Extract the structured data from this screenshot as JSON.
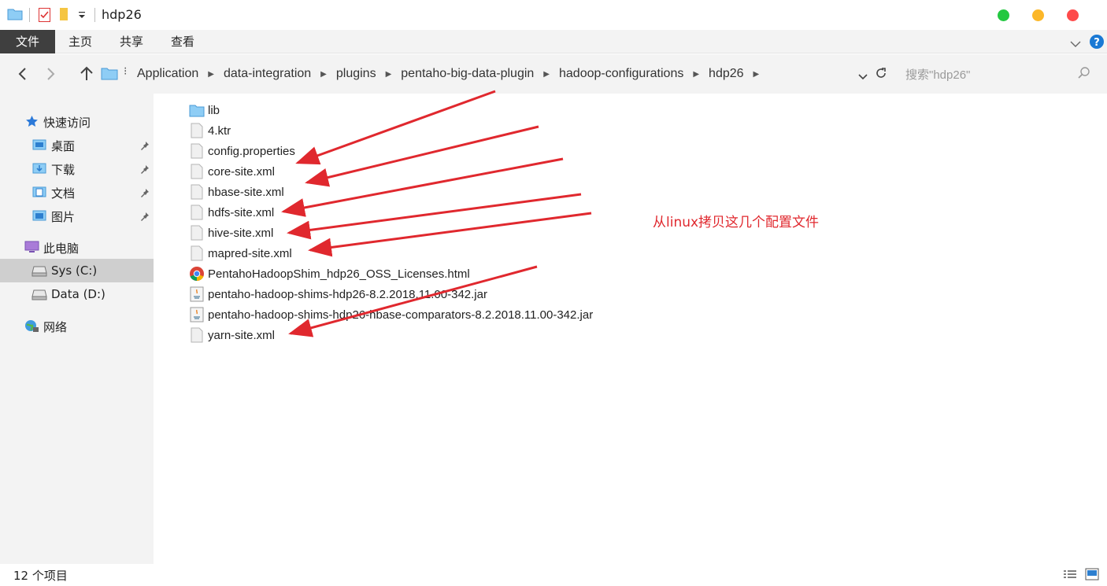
{
  "window": {
    "title": "hdp26"
  },
  "ribbon": {
    "tabs": [
      {
        "label": "文件"
      },
      {
        "label": "主页"
      },
      {
        "label": "共享"
      },
      {
        "label": "查看"
      }
    ]
  },
  "address": {
    "crumbs": [
      "Application",
      "data-integration",
      "plugins",
      "pentaho-big-data-plugin",
      "hadoop-configurations",
      "hdp26"
    ],
    "search_placeholder": "搜索\"hdp26\""
  },
  "sidebar": {
    "items": [
      {
        "label": "快速访问",
        "icon": "star-icon"
      },
      {
        "label": "桌面",
        "icon": "desktop-folder-icon",
        "pinned": true
      },
      {
        "label": "下载",
        "icon": "download-folder-icon",
        "pinned": true
      },
      {
        "label": "文档",
        "icon": "documents-folder-icon",
        "pinned": true
      },
      {
        "label": "图片",
        "icon": "pictures-folder-icon",
        "pinned": true
      },
      {
        "label": "此电脑",
        "icon": "computer-icon"
      },
      {
        "label": "Sys (C:)",
        "icon": "drive-icon",
        "selected": true
      },
      {
        "label": "Data (D:)",
        "icon": "drive-icon"
      },
      {
        "label": "网络",
        "icon": "network-icon"
      }
    ]
  },
  "files": [
    {
      "name": "lib",
      "type": "folder"
    },
    {
      "name": "4.ktr",
      "type": "file"
    },
    {
      "name": "config.properties",
      "type": "file"
    },
    {
      "name": "core-site.xml",
      "type": "file"
    },
    {
      "name": "hbase-site.xml",
      "type": "file"
    },
    {
      "name": "hdfs-site.xml",
      "type": "file"
    },
    {
      "name": "hive-site.xml",
      "type": "file"
    },
    {
      "name": "mapred-site.xml",
      "type": "file"
    },
    {
      "name": "PentahoHadoopShim_hdp26_OSS_Licenses.html",
      "type": "html"
    },
    {
      "name": "pentaho-hadoop-shims-hdp26-8.2.2018.11.00-342.jar",
      "type": "jar"
    },
    {
      "name": "pentaho-hadoop-shims-hdp26-hbase-comparators-8.2.2018.11.00-342.jar",
      "type": "jar"
    },
    {
      "name": "yarn-site.xml",
      "type": "file"
    }
  ],
  "annotation": {
    "text": "从linux拷贝这几个配置文件",
    "color": "#e0282e"
  },
  "status": {
    "item_count": "12 个项目"
  },
  "colors": {
    "selected": "#cfcfcf",
    "pane": "#f3f3f3",
    "accent": "#1a79d4"
  }
}
